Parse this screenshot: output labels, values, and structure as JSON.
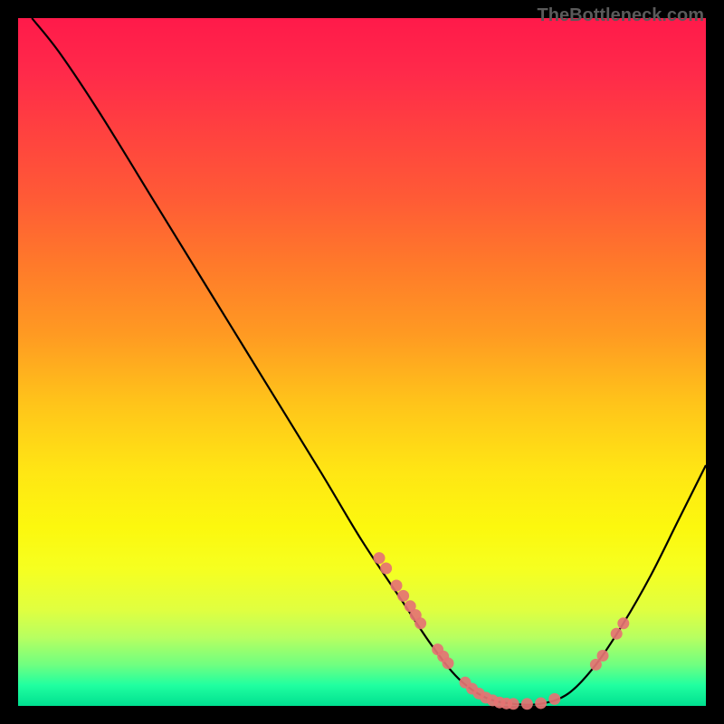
{
  "watermark": "TheBottleneck.com",
  "chart_data": {
    "type": "line",
    "title": "",
    "xlabel": "",
    "ylabel": "",
    "xlim": [
      0,
      100
    ],
    "ylim": [
      0,
      100
    ],
    "curve": [
      {
        "x": 2,
        "y": 100
      },
      {
        "x": 6,
        "y": 95
      },
      {
        "x": 12,
        "y": 86
      },
      {
        "x": 20,
        "y": 73
      },
      {
        "x": 28,
        "y": 60
      },
      {
        "x": 36,
        "y": 47
      },
      {
        "x": 44,
        "y": 34
      },
      {
        "x": 50,
        "y": 24
      },
      {
        "x": 56,
        "y": 15
      },
      {
        "x": 60,
        "y": 9
      },
      {
        "x": 64,
        "y": 4
      },
      {
        "x": 68,
        "y": 1.2
      },
      {
        "x": 72,
        "y": 0.3
      },
      {
        "x": 76,
        "y": 0.3
      },
      {
        "x": 80,
        "y": 1.8
      },
      {
        "x": 84,
        "y": 6
      },
      {
        "x": 88,
        "y": 12
      },
      {
        "x": 92,
        "y": 19
      },
      {
        "x": 96,
        "y": 27
      },
      {
        "x": 100,
        "y": 35
      }
    ],
    "points": [
      {
        "x": 52.5,
        "y": 21.5
      },
      {
        "x": 53.5,
        "y": 20
      },
      {
        "x": 55,
        "y": 17.5
      },
      {
        "x": 56,
        "y": 16
      },
      {
        "x": 57,
        "y": 14.5
      },
      {
        "x": 57.8,
        "y": 13.2
      },
      {
        "x": 58.5,
        "y": 12
      },
      {
        "x": 61,
        "y": 8.2
      },
      {
        "x": 61.8,
        "y": 7.2
      },
      {
        "x": 62.5,
        "y": 6.2
      },
      {
        "x": 65,
        "y": 3.4
      },
      {
        "x": 66,
        "y": 2.5
      },
      {
        "x": 67,
        "y": 1.8
      },
      {
        "x": 68,
        "y": 1.2
      },
      {
        "x": 69,
        "y": 0.8
      },
      {
        "x": 70,
        "y": 0.5
      },
      {
        "x": 71,
        "y": 0.35
      },
      {
        "x": 72,
        "y": 0.3
      },
      {
        "x": 74,
        "y": 0.3
      },
      {
        "x": 76,
        "y": 0.4
      },
      {
        "x": 78,
        "y": 1
      },
      {
        "x": 84,
        "y": 6
      },
      {
        "x": 85,
        "y": 7.3
      },
      {
        "x": 87,
        "y": 10.5
      },
      {
        "x": 88,
        "y": 12
      }
    ],
    "gradient_stops": [
      {
        "pos": 0,
        "color": "#ff1a4a"
      },
      {
        "pos": 50,
        "color": "#ffb01e"
      },
      {
        "pos": 80,
        "color": "#f6ff20"
      },
      {
        "pos": 100,
        "color": "#00e090"
      }
    ]
  }
}
